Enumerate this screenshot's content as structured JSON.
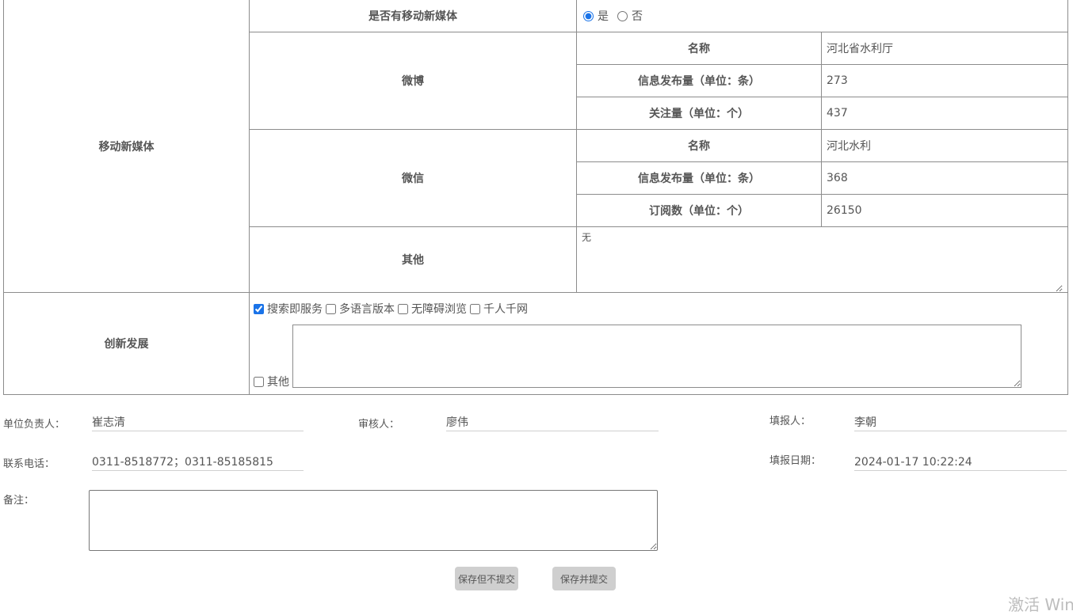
{
  "media": {
    "section_label": "移动新媒体",
    "has_mobile_label": "是否有移动新媒体",
    "radio_yes": "是",
    "radio_no": "否",
    "selected": "是",
    "weibo": {
      "label": "微博",
      "rows": [
        {
          "label": "名称",
          "value": "河北省水利厅"
        },
        {
          "label": "信息发布量（单位：条）",
          "value": "273"
        },
        {
          "label": "关注量（单位：个）",
          "value": "437"
        }
      ]
    },
    "wechat": {
      "label": "微信",
      "rows": [
        {
          "label": "名称",
          "value": "河北水利"
        },
        {
          "label": "信息发布量（单位：条）",
          "value": "368"
        },
        {
          "label": "订阅数（单位：个）",
          "value": "26150"
        }
      ]
    },
    "other": {
      "label": "其他",
      "value": "无"
    }
  },
  "innovation": {
    "label": "创新发展",
    "options": [
      {
        "label": "搜索即服务",
        "checked": true
      },
      {
        "label": "多语言版本",
        "checked": false
      },
      {
        "label": "无障碍浏览",
        "checked": false
      },
      {
        "label": "千人千网",
        "checked": false
      }
    ],
    "other_label": "其他",
    "other_value": ""
  },
  "footer": {
    "unit_leader_label": "单位负责人：",
    "unit_leader_value": "崔志清",
    "reviewer_label": "审核人：",
    "reviewer_value": "廖伟",
    "filler_label": "填报人：",
    "filler_value": "李朝",
    "phone_label": "联系电话：",
    "phone_value": "0311-8518772；0311-85185815",
    "date_label": "填报日期：",
    "date_value": "2024-01-17 10:22:24",
    "remark_label": "备注：",
    "remark_value": ""
  },
  "buttons": {
    "save_no_submit": "保存但不提交",
    "save_submit": "保存并提交"
  },
  "watermark": "激活 Win"
}
